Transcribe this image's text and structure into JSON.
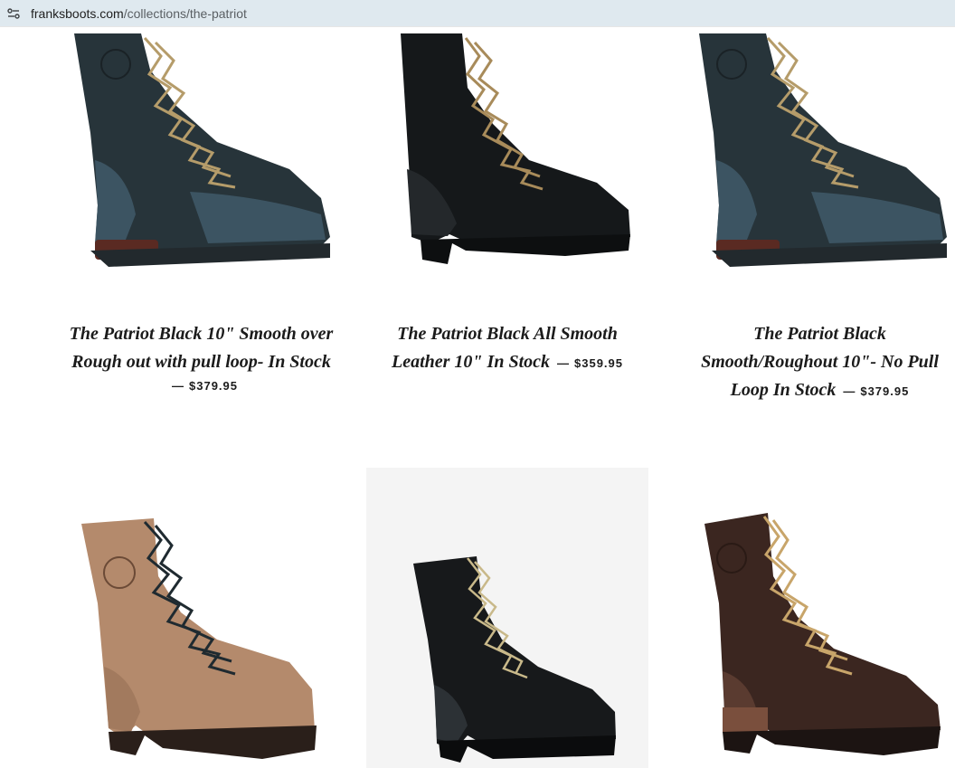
{
  "browser": {
    "url_domain": "franksboots.com",
    "url_path": "/collections/the-patriot",
    "site_settings_icon": "tune-icon"
  },
  "products": [
    {
      "title": "The Patriot Black 10\" Smooth over Rough out with pull loop- In Stock",
      "separator": "—",
      "price": "$379.95",
      "boot_color": "#27343a",
      "accent": "#4a6877"
    },
    {
      "title": "The Patriot Black All Smooth Leather 10\" In Stock",
      "separator": "—",
      "price": "$359.95",
      "boot_color": "#15181a",
      "accent": "#2a2f33"
    },
    {
      "title": "The Patriot Black Smooth/Roughout 10\"- No Pull Loop In Stock",
      "separator": "—",
      "price": "$379.95",
      "boot_color": "#27343a",
      "accent": "#4a6877"
    },
    {
      "title": "",
      "separator": "",
      "price": "",
      "boot_color": "#b48a6c",
      "accent": "#8e6a52"
    },
    {
      "title": "",
      "separator": "",
      "price": "",
      "boot_color": "#17191b",
      "accent": "#2c3135"
    },
    {
      "title": "",
      "separator": "",
      "price": "",
      "boot_color": "#3b2620",
      "accent": "#5a3b30"
    }
  ]
}
